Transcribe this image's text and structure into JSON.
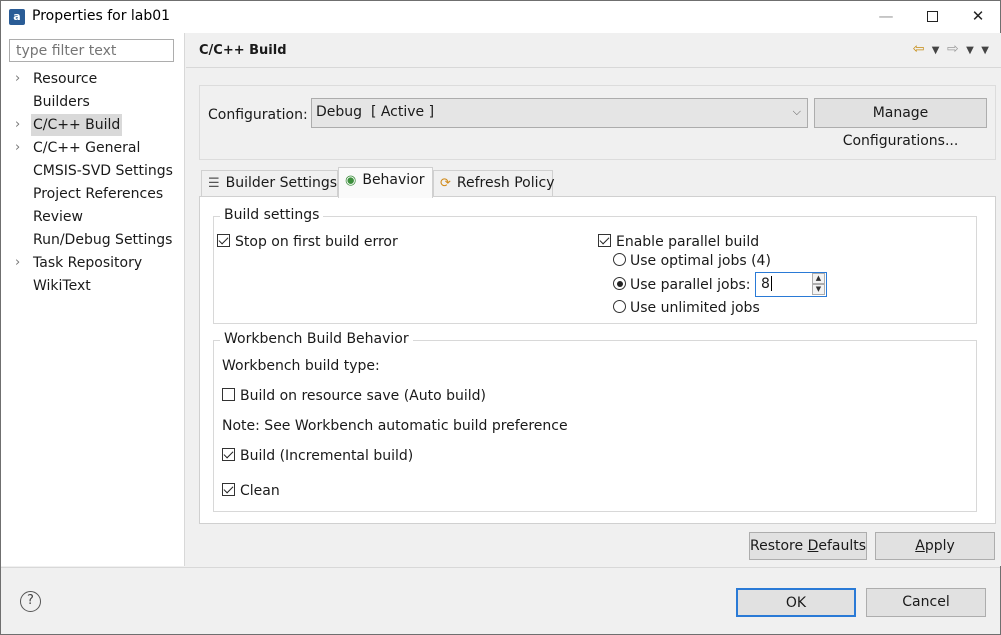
{
  "window": {
    "title": "Properties for lab01"
  },
  "filter": {
    "placeholder": "type filter text"
  },
  "tree": [
    {
      "label": "Resource",
      "expandable": true
    },
    {
      "label": "Builders",
      "expandable": false
    },
    {
      "label": "C/C++ Build",
      "expandable": true,
      "selected": true
    },
    {
      "label": "C/C++ General",
      "expandable": true
    },
    {
      "label": "CMSIS-SVD Settings",
      "expandable": false
    },
    {
      "label": "Project References",
      "expandable": false
    },
    {
      "label": "Review",
      "expandable": false
    },
    {
      "label": "Run/Debug Settings",
      "expandable": false
    },
    {
      "label": "Task Repository",
      "expandable": true
    },
    {
      "label": "WikiText",
      "expandable": false
    }
  ],
  "page": {
    "title": "C/C++ Build"
  },
  "config": {
    "label": "Configuration:",
    "value": "Debug  [ Active ]",
    "manage_label": "Manage Configurations..."
  },
  "tabs": [
    {
      "label": "Builder Settings",
      "icon": "list-icon"
    },
    {
      "label": "Behavior",
      "icon": "radio-icon",
      "active": true
    },
    {
      "label": "Refresh Policy",
      "icon": "refresh-icon"
    }
  ],
  "build_settings": {
    "legend": "Build settings",
    "stop_on_error": {
      "label": "Stop on first build error",
      "checked": true
    },
    "parallel": {
      "label": "Enable parallel build",
      "checked": true
    },
    "optimal_jobs": {
      "label": "Use optimal jobs (4)",
      "selected": false
    },
    "parallel_jobs": {
      "label": "Use parallel jobs:",
      "selected": true,
      "value": "8"
    },
    "unlimited_jobs": {
      "label": "Use unlimited jobs",
      "selected": false
    }
  },
  "workbench": {
    "legend": "Workbench Build Behavior",
    "build_type_label": "Workbench build type:",
    "auto_build": {
      "label": "Build on resource save (Auto build)",
      "checked": false
    },
    "note": "Note: See Workbench automatic build preference",
    "incremental": {
      "label": "Build (Incremental build)",
      "checked": true
    },
    "clean": {
      "label": "Clean",
      "checked": true
    }
  },
  "buttons": {
    "restore_pre": "Restore ",
    "restore_acc": "D",
    "restore_post": "efaults",
    "apply_acc": "A",
    "apply_post": "pply",
    "ok": "OK",
    "cancel": "Cancel"
  }
}
